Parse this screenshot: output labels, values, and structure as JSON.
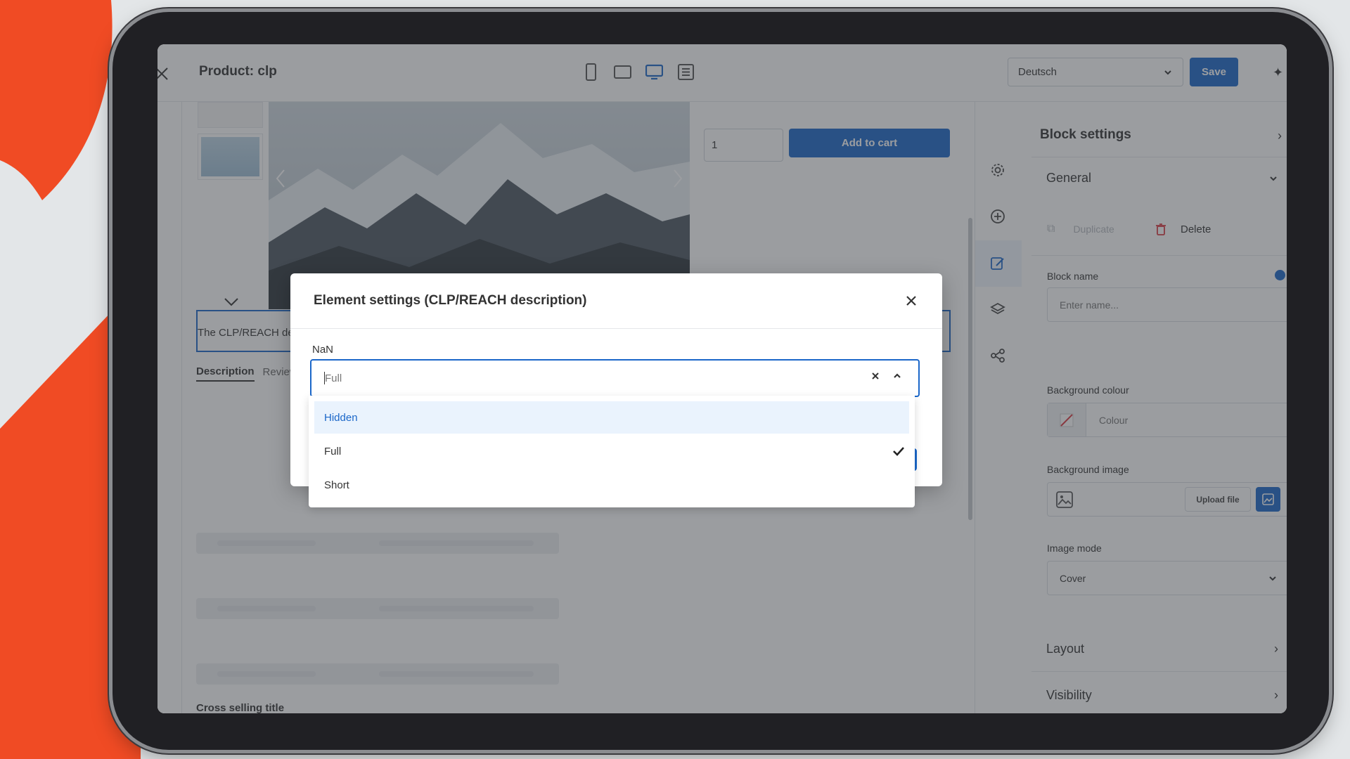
{
  "header": {
    "title": "Product: clp",
    "language": "Deutsch",
    "save_label": "Save"
  },
  "product": {
    "quantity": "1",
    "add_to_cart_label": "Add to cart",
    "description_preview": "The CLP/REACH de",
    "tabs": [
      "Description",
      "Review"
    ],
    "cross_selling_title": "Cross selling title"
  },
  "panel": {
    "title": "Block settings",
    "general_label": "General",
    "duplicate_label": "Duplicate",
    "delete_label": "Delete",
    "block_name_label": "Block name",
    "block_name_placeholder": "Enter name...",
    "bg_colour_label": "Background colour",
    "colour_placeholder": "Colour",
    "bg_image_label": "Background image",
    "upload_label": "Upload file",
    "image_mode_label": "Image mode",
    "image_mode_value": "Cover",
    "layout_label": "Layout",
    "visibility_label": "Visibility"
  },
  "modal": {
    "title": "Element settings (CLP/REACH description)",
    "field_label": "NaN",
    "select_value": "Full",
    "options": [
      {
        "label": "Hidden",
        "state": "highlighted"
      },
      {
        "label": "Full",
        "state": "selected"
      },
      {
        "label": "Short",
        "state": "none"
      }
    ]
  },
  "colors": {
    "accent": "#1b67c9",
    "brand_orange": "#f04b24",
    "delete_red": "#d9363e",
    "highlight_bg": "#eaf3fd"
  }
}
